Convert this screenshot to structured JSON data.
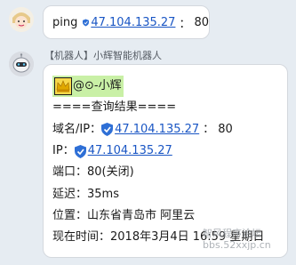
{
  "message_user": {
    "text": "ping",
    "ip": "47.104.135.27",
    "port": "80",
    "colon": "："
  },
  "message_bot": {
    "sender": "【机器人】小辉智能机器人",
    "mention": "@⊙-小辉",
    "title": "====查询结果====",
    "domain_label": "域名/IP：",
    "domain_ip": "47.104.135.27",
    "domain_port": "80",
    "ip_label": "IP：",
    "ip_value": "47.104.135.27",
    "port_line": "端口：80(关闭)",
    "latency_line": "延迟：35ms",
    "location_line": "位置：山东省青岛市  阿里云",
    "time_line": "现在时间：2018年3月4日 16:59 星期日",
    "colon": "："
  },
  "watermark": {
    "line1": "智风程序论坛",
    "line2": "bbs.52xxjp.cn"
  },
  "colors": {
    "background": "#e6ecf2",
    "bubble": "#ffffff",
    "link": "#1a56c4",
    "shield": "#2e6fd6",
    "mention_highlight": "#c9f0a6"
  }
}
